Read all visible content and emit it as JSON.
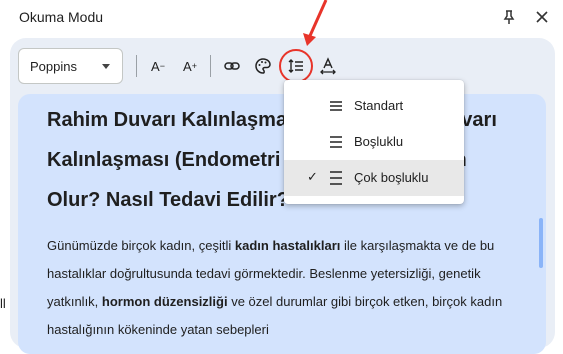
{
  "window": {
    "title": "Okuma Modu"
  },
  "toolbar": {
    "font": "Poppins",
    "decrease_label": "A",
    "decrease_sign": "−",
    "increase_label": "A",
    "increase_sign": "+"
  },
  "spacing_menu": {
    "items": [
      {
        "label": "Standart",
        "selected": false
      },
      {
        "label": "Boşluklu",
        "selected": false
      },
      {
        "label": "Çok boşluklu",
        "selected": true
      }
    ],
    "check": "✓"
  },
  "article": {
    "heading_lines": [
      "Rahim Duvarı Kalınlaşma",
      "uvarı",
      "Kalınlaşması (Endometri",
      "en",
      "Olur? Nasıl Tedavi Edilir?"
    ],
    "paragraph": [
      {
        "text": "Günümüzde birçok kadın, çeşitli ",
        "bold": false
      },
      {
        "text": "kadın hastalıkları",
        "bold": true
      },
      {
        "text": " ile karşılaşmakta ve de bu hastalıklar doğrultusunda tedavi görmektedir. Beslenme yetersizliği, genetik yatkınlık, ",
        "bold": false
      },
      {
        "text": "hormon düzensizliği",
        "bold": true
      },
      {
        "text": " ve özel durumlar gibi birçok etken, birçok kadın hastalığının kökeninde yatan sebepleri",
        "bold": false
      }
    ]
  },
  "edge_fragment": "ll",
  "colors": {
    "panel": "#e9eef6",
    "content": "#d3e3fd",
    "annotation": "#e8342a"
  }
}
